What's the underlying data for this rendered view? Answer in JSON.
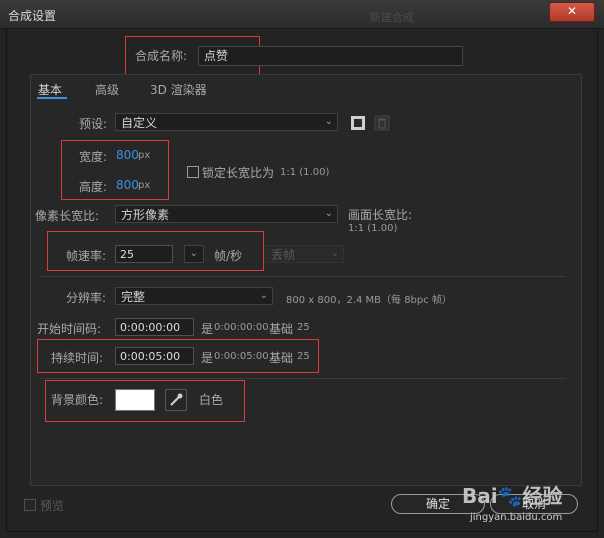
{
  "window": {
    "title": "合成设置",
    "ghost_title": "新建合成",
    "close_symbol": "✕"
  },
  "comp_name": {
    "label": "合成名称:",
    "value": "点赞"
  },
  "tabs": [
    {
      "label": "基本",
      "active": true
    },
    {
      "label": "高级",
      "active": false
    },
    {
      "label": "3D 渲染器",
      "active": false
    }
  ],
  "preset": {
    "label": "预设:",
    "value": "自定义"
  },
  "size": {
    "width_label": "宽度:",
    "width_value": "800",
    "height_label": "高度:",
    "height_value": "800",
    "unit": "px",
    "lock_label": "锁定长宽比为",
    "lock_ratio": "1:1 (1.00)",
    "lock_checked": false
  },
  "pixel_aspect": {
    "label": "像素长宽比:",
    "value": "方形像素",
    "frame_aspect_label": "画面长宽比:",
    "frame_aspect_value": "1:1 (1.00)"
  },
  "frame_rate": {
    "label": "帧速率:",
    "value": "25",
    "unit": "帧/秒",
    "drop_frame": "丢帧"
  },
  "resolution": {
    "label": "分辨率:",
    "value": "完整",
    "info": "800 x 800，2.4 MB（每 8bpc 帧）"
  },
  "start_timecode": {
    "label": "开始时间码:",
    "value": "0:00:00:00",
    "is_prefix": "是",
    "is_value": "0:00:00:00",
    "base_label": "基础",
    "base_value": "25"
  },
  "duration": {
    "label": "持续时间:",
    "value": "0:00:05:00",
    "is_prefix": "是",
    "is_value": "0:00:05:00",
    "base_label": "基础",
    "base_value": "25"
  },
  "background": {
    "label": "背景颜色:",
    "color_hex": "#ffffff",
    "color_name": "白色"
  },
  "footer": {
    "preview_label": "预览",
    "preview_checked": false,
    "ok_label": "确定",
    "cancel_label": "取消"
  },
  "watermark": {
    "brand_a": "Bai",
    "brand_b": "经验",
    "url": "jingyan.baidu.com"
  },
  "colors": {
    "accent": "#3d8fe0",
    "highlight_box": "#d93a3a",
    "background": "#232323"
  }
}
